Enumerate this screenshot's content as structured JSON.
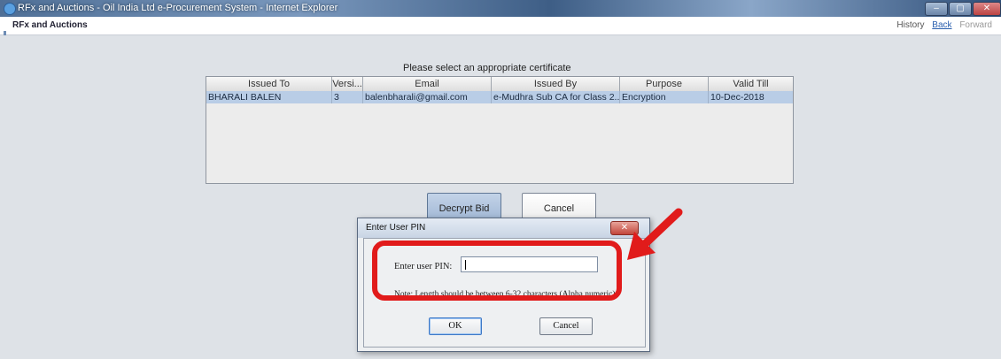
{
  "window": {
    "title": "RFx and Auctions - Oil India Ltd e-Procurement System - Internet Explorer",
    "buttons": [
      "–",
      "▢",
      "✕"
    ]
  },
  "app": {
    "title": "RFx and Auctions",
    "nav": {
      "history": "History",
      "back": "Back",
      "forward": "Forward"
    }
  },
  "certificate": {
    "prompt": "Please select an appropriate certificate",
    "columns": [
      "Issued To",
      "Versi...",
      "Email",
      "Issued By",
      "Purpose",
      "Valid Till"
    ],
    "rows": [
      {
        "issued_to": "BHARALI BALEN",
        "version": "3",
        "email": "balenbharali@gmail.com",
        "issued_by": "e-Mudhra Sub CA for Class 2...",
        "purpose": "Encryption",
        "valid_till": "10-Dec-2018"
      }
    ]
  },
  "actions": {
    "decrypt": "Decrypt Bid",
    "cancel": "Cancel"
  },
  "pin_dialog": {
    "title": "Enter User PIN",
    "close": "✕",
    "label": "Enter user PIN:",
    "value": "",
    "note": "Note: Length should be between 6-32 characters (Alpha numeric)",
    "ok": "OK",
    "cancel": "Cancel"
  },
  "annotation": {
    "color": "#e11b1b"
  }
}
